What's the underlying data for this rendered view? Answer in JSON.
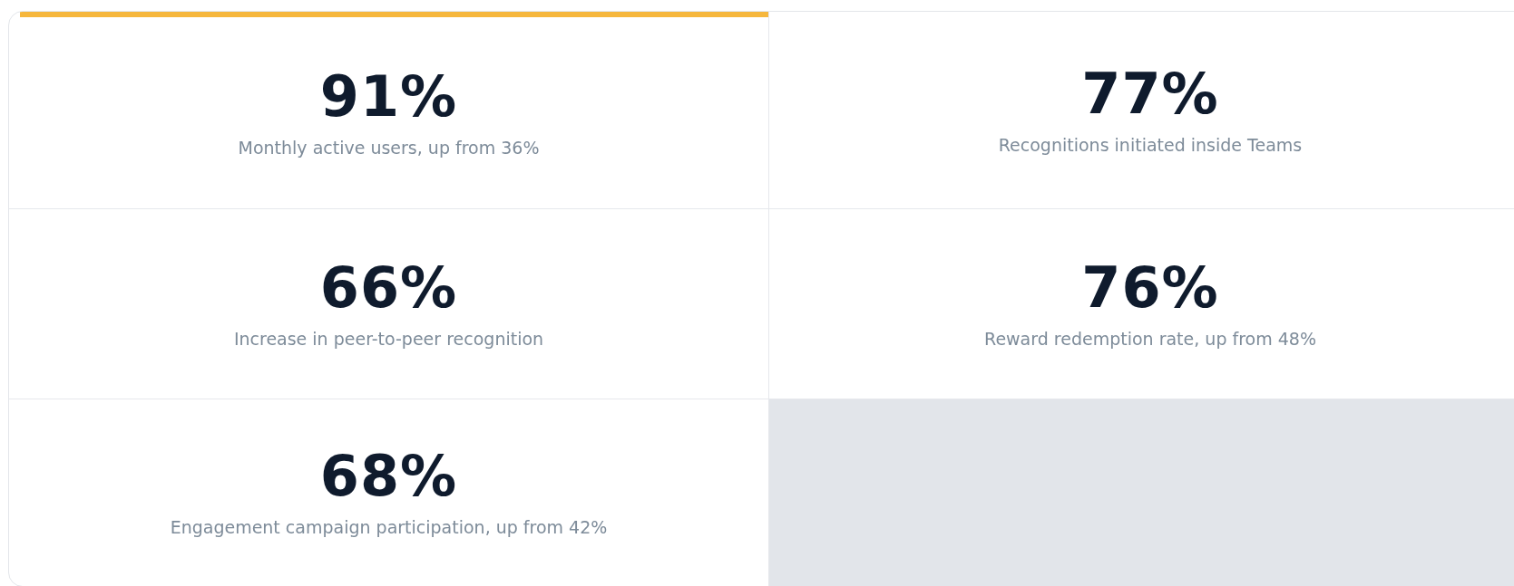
{
  "stats": [
    {
      "value": "91%",
      "label": "Monthly active users, up from 36%",
      "highlighted": true
    },
    {
      "value": "77%",
      "label": "Recognitions initiated inside Teams",
      "highlighted": false
    },
    {
      "value": "66%",
      "label": "Increase in peer-to-peer recognition",
      "highlighted": false
    },
    {
      "value": "76%",
      "label": "Reward redemption rate, up from 48%",
      "highlighted": false
    },
    {
      "value": "68%",
      "label": "Engagement campaign participation, up from 42%",
      "highlighted": false
    }
  ]
}
